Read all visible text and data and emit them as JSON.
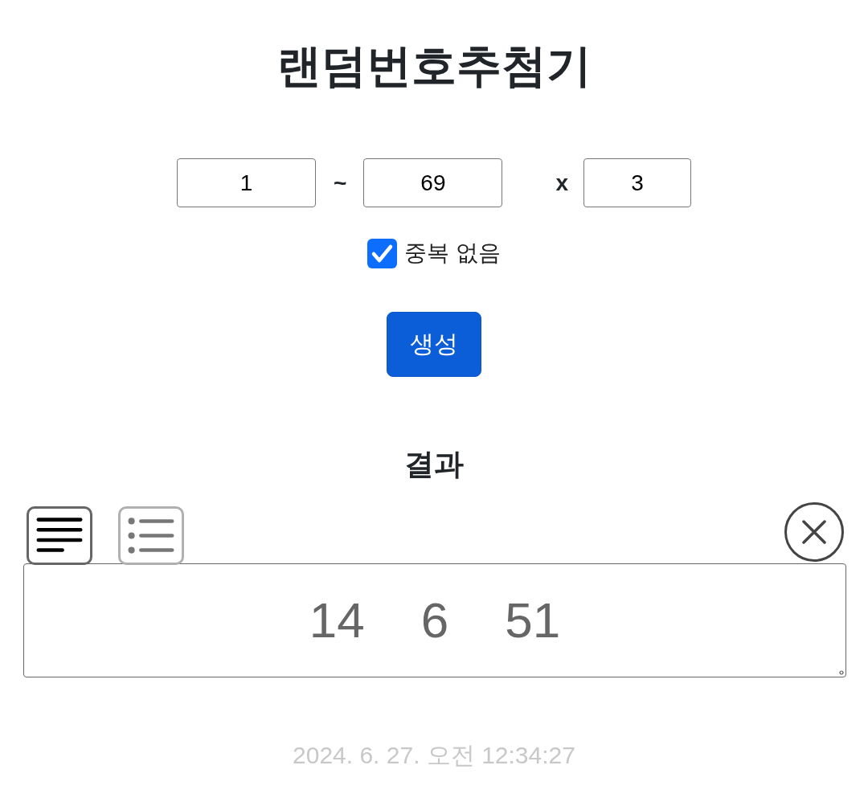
{
  "title": "랜덤번호추첨기",
  "range": {
    "min": "1",
    "separator": "~",
    "max": "69",
    "times_label": "x",
    "count": "3"
  },
  "no_duplicates": {
    "label": "중복 없음",
    "checked": true
  },
  "generate_button": "생성",
  "result": {
    "heading": "결과",
    "view_tabs": [
      {
        "kind": "text",
        "selected": true
      },
      {
        "kind": "list",
        "selected": false
      }
    ],
    "numbers": [
      "14",
      "6",
      "51"
    ]
  },
  "timestamp": "2024. 6. 27. 오전 12:34:27"
}
